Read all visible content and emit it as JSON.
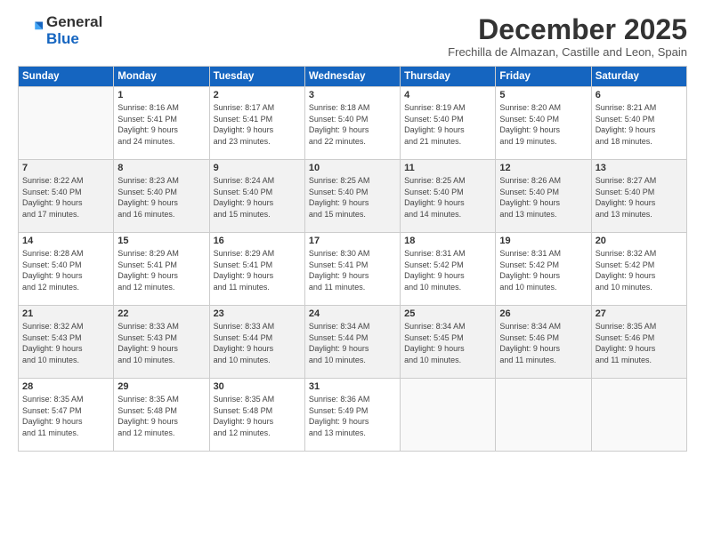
{
  "logo": {
    "general": "General",
    "blue": "Blue"
  },
  "header": {
    "month": "December 2025",
    "location": "Frechilla de Almazan, Castille and Leon, Spain"
  },
  "weekdays": [
    "Sunday",
    "Monday",
    "Tuesday",
    "Wednesday",
    "Thursday",
    "Friday",
    "Saturday"
  ],
  "weeks": [
    [
      {
        "day": "",
        "info": ""
      },
      {
        "day": "1",
        "info": "Sunrise: 8:16 AM\nSunset: 5:41 PM\nDaylight: 9 hours\nand 24 minutes."
      },
      {
        "day": "2",
        "info": "Sunrise: 8:17 AM\nSunset: 5:41 PM\nDaylight: 9 hours\nand 23 minutes."
      },
      {
        "day": "3",
        "info": "Sunrise: 8:18 AM\nSunset: 5:40 PM\nDaylight: 9 hours\nand 22 minutes."
      },
      {
        "day": "4",
        "info": "Sunrise: 8:19 AM\nSunset: 5:40 PM\nDaylight: 9 hours\nand 21 minutes."
      },
      {
        "day": "5",
        "info": "Sunrise: 8:20 AM\nSunset: 5:40 PM\nDaylight: 9 hours\nand 19 minutes."
      },
      {
        "day": "6",
        "info": "Sunrise: 8:21 AM\nSunset: 5:40 PM\nDaylight: 9 hours\nand 18 minutes."
      }
    ],
    [
      {
        "day": "7",
        "info": "Sunrise: 8:22 AM\nSunset: 5:40 PM\nDaylight: 9 hours\nand 17 minutes."
      },
      {
        "day": "8",
        "info": "Sunrise: 8:23 AM\nSunset: 5:40 PM\nDaylight: 9 hours\nand 16 minutes."
      },
      {
        "day": "9",
        "info": "Sunrise: 8:24 AM\nSunset: 5:40 PM\nDaylight: 9 hours\nand 15 minutes."
      },
      {
        "day": "10",
        "info": "Sunrise: 8:25 AM\nSunset: 5:40 PM\nDaylight: 9 hours\nand 15 minutes."
      },
      {
        "day": "11",
        "info": "Sunrise: 8:25 AM\nSunset: 5:40 PM\nDaylight: 9 hours\nand 14 minutes."
      },
      {
        "day": "12",
        "info": "Sunrise: 8:26 AM\nSunset: 5:40 PM\nDaylight: 9 hours\nand 13 minutes."
      },
      {
        "day": "13",
        "info": "Sunrise: 8:27 AM\nSunset: 5:40 PM\nDaylight: 9 hours\nand 13 minutes."
      }
    ],
    [
      {
        "day": "14",
        "info": "Sunrise: 8:28 AM\nSunset: 5:40 PM\nDaylight: 9 hours\nand 12 minutes."
      },
      {
        "day": "15",
        "info": "Sunrise: 8:29 AM\nSunset: 5:41 PM\nDaylight: 9 hours\nand 12 minutes."
      },
      {
        "day": "16",
        "info": "Sunrise: 8:29 AM\nSunset: 5:41 PM\nDaylight: 9 hours\nand 11 minutes."
      },
      {
        "day": "17",
        "info": "Sunrise: 8:30 AM\nSunset: 5:41 PM\nDaylight: 9 hours\nand 11 minutes."
      },
      {
        "day": "18",
        "info": "Sunrise: 8:31 AM\nSunset: 5:42 PM\nDaylight: 9 hours\nand 10 minutes."
      },
      {
        "day": "19",
        "info": "Sunrise: 8:31 AM\nSunset: 5:42 PM\nDaylight: 9 hours\nand 10 minutes."
      },
      {
        "day": "20",
        "info": "Sunrise: 8:32 AM\nSunset: 5:42 PM\nDaylight: 9 hours\nand 10 minutes."
      }
    ],
    [
      {
        "day": "21",
        "info": "Sunrise: 8:32 AM\nSunset: 5:43 PM\nDaylight: 9 hours\nand 10 minutes."
      },
      {
        "day": "22",
        "info": "Sunrise: 8:33 AM\nSunset: 5:43 PM\nDaylight: 9 hours\nand 10 minutes."
      },
      {
        "day": "23",
        "info": "Sunrise: 8:33 AM\nSunset: 5:44 PM\nDaylight: 9 hours\nand 10 minutes."
      },
      {
        "day": "24",
        "info": "Sunrise: 8:34 AM\nSunset: 5:44 PM\nDaylight: 9 hours\nand 10 minutes."
      },
      {
        "day": "25",
        "info": "Sunrise: 8:34 AM\nSunset: 5:45 PM\nDaylight: 9 hours\nand 10 minutes."
      },
      {
        "day": "26",
        "info": "Sunrise: 8:34 AM\nSunset: 5:46 PM\nDaylight: 9 hours\nand 11 minutes."
      },
      {
        "day": "27",
        "info": "Sunrise: 8:35 AM\nSunset: 5:46 PM\nDaylight: 9 hours\nand 11 minutes."
      }
    ],
    [
      {
        "day": "28",
        "info": "Sunrise: 8:35 AM\nSunset: 5:47 PM\nDaylight: 9 hours\nand 11 minutes."
      },
      {
        "day": "29",
        "info": "Sunrise: 8:35 AM\nSunset: 5:48 PM\nDaylight: 9 hours\nand 12 minutes."
      },
      {
        "day": "30",
        "info": "Sunrise: 8:35 AM\nSunset: 5:48 PM\nDaylight: 9 hours\nand 12 minutes."
      },
      {
        "day": "31",
        "info": "Sunrise: 8:36 AM\nSunset: 5:49 PM\nDaylight: 9 hours\nand 13 minutes."
      },
      {
        "day": "",
        "info": ""
      },
      {
        "day": "",
        "info": ""
      },
      {
        "day": "",
        "info": ""
      }
    ]
  ]
}
